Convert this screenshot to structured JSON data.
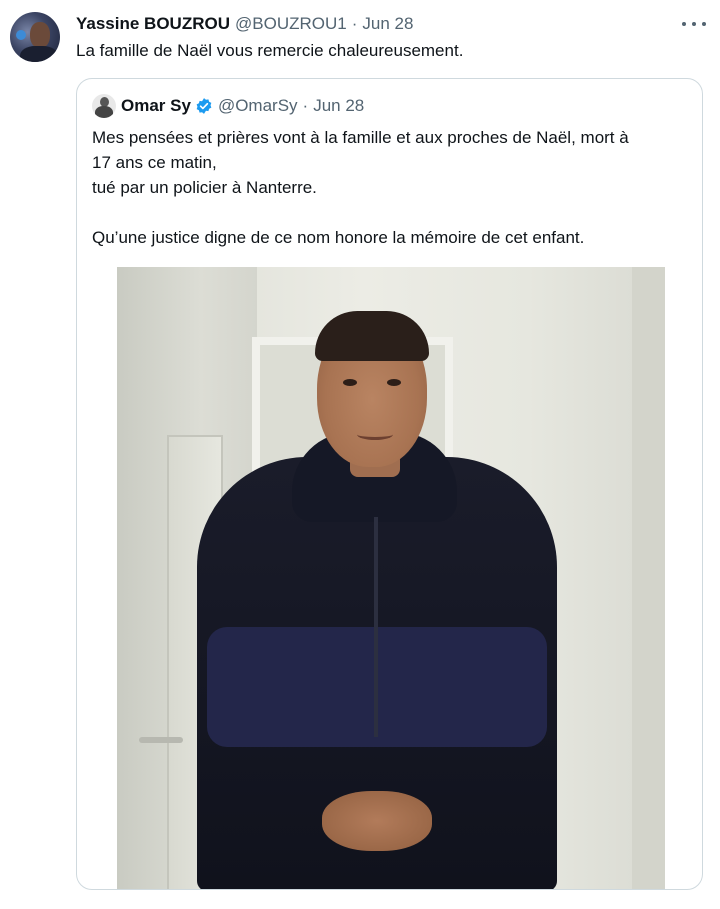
{
  "tweet": {
    "author_name": "Yassine BOUZROU",
    "author_handle": "@BOUZROU1",
    "separator": "·",
    "date": "Jun 28",
    "text": "La famille de Naël vous remercie chaleureusement."
  },
  "quoted": {
    "author_name": "Omar Sy",
    "author_handle": "@OmarSy",
    "separator": "·",
    "date": "Jun 28",
    "verified": true,
    "lines": [
      "Mes pensées et prières vont à la famille et aux proches de Naël, mort à",
      "17 ans ce matin,",
      "tué par un policier à Nanterre.",
      "",
      "Qu’une justice digne de ce nom honore la mémoire de cet enfant."
    ]
  },
  "icons": {
    "more": "more-icon",
    "verified": "verified-icon"
  },
  "colors": {
    "text_primary": "#0f1419",
    "text_secondary": "#536471",
    "border": "#cfd9de",
    "verified_blue": "#1d9bf0"
  }
}
